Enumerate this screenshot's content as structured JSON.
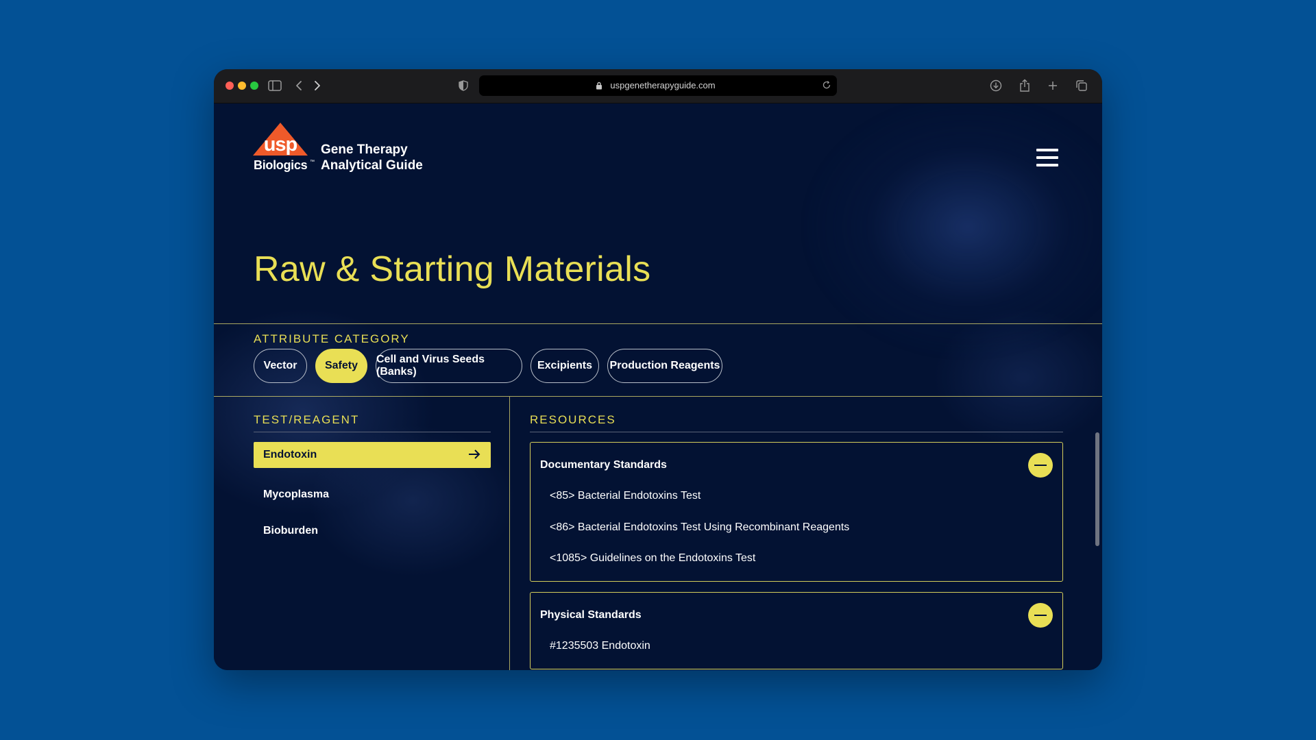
{
  "browser": {
    "url": "uspgenetherapyguide.com"
  },
  "brand": {
    "logo_text": "usp",
    "wordmark": "Biologics",
    "trademark": "™",
    "site_title_line1": "Gene Therapy",
    "site_title_line2": "Analytical Guide"
  },
  "page": {
    "title": "Raw & Starting Materials"
  },
  "attribute_category": {
    "label": "ATTRIBUTE CATEGORY",
    "pills": [
      {
        "label": "Vector",
        "active": false
      },
      {
        "label": "Safety",
        "active": true
      },
      {
        "label": "Cell and Virus Seeds (Banks)",
        "active": false
      },
      {
        "label": "Excipients",
        "active": false
      },
      {
        "label": "Production Reagents",
        "active": false
      }
    ]
  },
  "test_reagent": {
    "label": "TEST/REAGENT",
    "items": [
      {
        "label": "Endotoxin",
        "active": true
      },
      {
        "label": "Mycoplasma",
        "active": false
      },
      {
        "label": "Bioburden",
        "active": false
      }
    ]
  },
  "resources": {
    "label": "RESOURCES",
    "sections": [
      {
        "title": "Documentary Standards",
        "items": [
          "<85> Bacterial Endotoxins Test",
          "<86> Bacterial Endotoxins Test Using Recombinant Reagents",
          "<1085> Guidelines on the Endotoxins Test"
        ]
      },
      {
        "title": "Physical Standards",
        "items": [
          "#1235503 Endotoxin"
        ]
      }
    ]
  },
  "colors": {
    "accent": "#e9df55",
    "background": "#031233",
    "desktop": "#035195"
  }
}
